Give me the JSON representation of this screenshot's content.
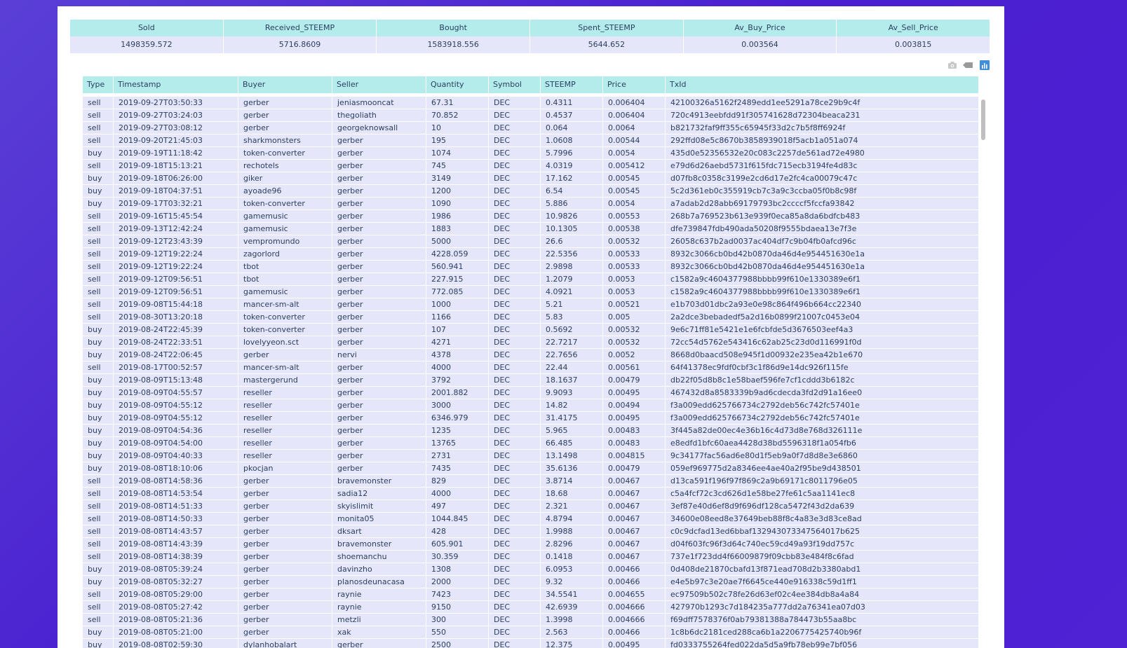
{
  "summary": {
    "headers": [
      "Sold",
      "Received_STEEMP",
      "Bought",
      "Spent_STEEMP",
      "Av_Buy_Price",
      "Av_Sell_Price"
    ],
    "values": [
      "1498359.572",
      "5716.8609",
      "1583918.556",
      "5644.652",
      "0.003564",
      "0.003815"
    ]
  },
  "modebar": {
    "icons": [
      "camera-icon",
      "eraser-icon",
      "bar-chart-icon"
    ]
  },
  "table": {
    "headers": [
      "Type",
      "Timestamp",
      "Buyer",
      "Seller",
      "Quantity",
      "Symbol",
      "STEEMP",
      "Price",
      "TxId"
    ],
    "rows": [
      [
        "sell",
        "2019-09-27T03:50:33",
        "gerber",
        "jeniasmooncat",
        "67.31",
        "DEC",
        "0.4311",
        "0.006404",
        "42100326a5162f2489edd1ee5291a78ce29b9c4f"
      ],
      [
        "sell",
        "2019-09-27T03:24:03",
        "gerber",
        "thegoliath",
        "70.852",
        "DEC",
        "0.4537",
        "0.006404",
        "720c4913eebfdd91f305741628d72304beaca231"
      ],
      [
        "sell",
        "2019-09-27T03:08:12",
        "gerber",
        "georgeknowsall",
        "10",
        "DEC",
        "0.064",
        "0.0064",
        "b821732faf9ff355c65945f33d2c7b5f8ff6924f"
      ],
      [
        "sell",
        "2019-09-20T21:45:03",
        "sharkmonsters",
        "gerber",
        "195",
        "DEC",
        "1.0608",
        "0.00544",
        "292ffd08e5c8670b3858939018f5acb1a051a074"
      ],
      [
        "buy",
        "2019-09-19T11:18:42",
        "token-converter",
        "gerber",
        "1074",
        "DEC",
        "5.7996",
        "0.0054",
        "435d0e52356532e20c083c2257de561ad72e4980"
      ],
      [
        "sell",
        "2019-09-18T15:13:21",
        "rechotels",
        "gerber",
        "745",
        "DEC",
        "4.0319",
        "0.005412",
        "e79d6d26aebd5731f615fdc715ecb3194fe4d83c"
      ],
      [
        "buy",
        "2019-09-18T06:26:00",
        "giker",
        "gerber",
        "3149",
        "DEC",
        "17.162",
        "0.00545",
        "d07fb8c0358c3199e2cd6d17e2fc4ca00079c47c"
      ],
      [
        "buy",
        "2019-09-18T04:37:51",
        "ayoade96",
        "gerber",
        "1200",
        "DEC",
        "6.54",
        "0.00545",
        "5c2d361eb0c355919cb7c3a9c3ccba05f0b8c98f"
      ],
      [
        "buy",
        "2019-09-17T03:32:21",
        "token-converter",
        "gerber",
        "1090",
        "DEC",
        "5.886",
        "0.0054",
        "a7adab2d28abb69179793bc2ccccf5fccfa93842"
      ],
      [
        "sell",
        "2019-09-16T15:45:54",
        "gamemusic",
        "gerber",
        "1986",
        "DEC",
        "10.9826",
        "0.00553",
        "268b7a769523b613e939f0eca85a8da6bdfcb483"
      ],
      [
        "sell",
        "2019-09-13T12:42:24",
        "gamemusic",
        "gerber",
        "1883",
        "DEC",
        "10.1305",
        "0.00538",
        "dfe739847fdb490ada50208f9555bdaea13e7f3e"
      ],
      [
        "sell",
        "2019-09-12T23:43:39",
        "vempromundo",
        "gerber",
        "5000",
        "DEC",
        "26.6",
        "0.00532",
        "26058c637b2ad0037ac404df7c9b04fb0afcd96c"
      ],
      [
        "sell",
        "2019-09-12T19:22:24",
        "zagorlord",
        "gerber",
        "4228.059",
        "DEC",
        "22.5356",
        "0.00533",
        "8932c3066cb0bd42b0870da46d4e954451630e1a"
      ],
      [
        "sell",
        "2019-09-12T19:22:24",
        "tbot",
        "gerber",
        "560.941",
        "DEC",
        "2.9898",
        "0.00533",
        "8932c3066cb0bd42b0870da46d4e954451630e1a"
      ],
      [
        "sell",
        "2019-09-12T09:56:51",
        "tbot",
        "gerber",
        "227.915",
        "DEC",
        "1.2079",
        "0.0053",
        "c1582a9c4604377988bbbb99f610e1330389e6f1"
      ],
      [
        "sell",
        "2019-09-12T09:56:51",
        "gamemusic",
        "gerber",
        "772.085",
        "DEC",
        "4.0921",
        "0.0053",
        "c1582a9c4604377988bbbb99f610e1330389e6f1"
      ],
      [
        "sell",
        "2019-09-08T15:44:18",
        "mancer-sm-alt",
        "gerber",
        "1000",
        "DEC",
        "5.21",
        "0.00521",
        "e1b703d01dbc2a93e0e98c864f496b664cc22340"
      ],
      [
        "sell",
        "2019-08-30T13:20:18",
        "token-converter",
        "gerber",
        "1166",
        "DEC",
        "5.83",
        "0.005",
        "2a2dce3bebadedf5a2d16b0899f21007c0453e04"
      ],
      [
        "buy",
        "2019-08-24T22:45:39",
        "token-converter",
        "gerber",
        "107",
        "DEC",
        "0.5692",
        "0.00532",
        "9e6c71ff81e5421e1e6fcbfde5d3676503eef4a3"
      ],
      [
        "buy",
        "2019-08-24T22:33:51",
        "lovelyyeon.sct",
        "gerber",
        "4271",
        "DEC",
        "22.7217",
        "0.00532",
        "72cc54d5762e543416c62ab25c23d0d116991f0d"
      ],
      [
        "buy",
        "2019-08-24T22:06:45",
        "gerber",
        "nervi",
        "4378",
        "DEC",
        "22.7656",
        "0.0052",
        "8668d0baacd508e945f1d00932e235ea42b1e670"
      ],
      [
        "sell",
        "2019-08-17T00:52:57",
        "mancer-sm-alt",
        "gerber",
        "4000",
        "DEC",
        "22.44",
        "0.00561",
        "64f41378ec9fdf0cbf3c1f86d9e14dc926f115fe"
      ],
      [
        "buy",
        "2019-08-09T15:13:48",
        "mastergerund",
        "gerber",
        "3792",
        "DEC",
        "18.1637",
        "0.00479",
        "db22f05d8b8c1e58baef596fe7cf1cddd3b6182c"
      ],
      [
        "buy",
        "2019-08-09T04:55:57",
        "reseller",
        "gerber",
        "2001.882",
        "DEC",
        "9.9093",
        "0.00495",
        "467432d8a8583339b9ad6cdecda3fd2d91a16ee0"
      ],
      [
        "buy",
        "2019-08-09T04:55:12",
        "reseller",
        "gerber",
        "3000",
        "DEC",
        "14.82",
        "0.00494",
        "f3a009edd625766734c2792deb56c742fc57401e"
      ],
      [
        "buy",
        "2019-08-09T04:55:12",
        "reseller",
        "gerber",
        "6346.979",
        "DEC",
        "31.4175",
        "0.00495",
        "f3a009edd625766734c2792deb56c742fc57401e"
      ],
      [
        "buy",
        "2019-08-09T04:54:36",
        "reseller",
        "gerber",
        "1235",
        "DEC",
        "5.965",
        "0.00483",
        "3f445a82de00ec4e36b16c4d73d8e768d326111e"
      ],
      [
        "buy",
        "2019-08-09T04:54:00",
        "reseller",
        "gerber",
        "13765",
        "DEC",
        "66.485",
        "0.00483",
        "e8edfd1bfc60aea4428d38bd5596318f1a054fb6"
      ],
      [
        "buy",
        "2019-08-09T04:40:33",
        "reseller",
        "gerber",
        "2731",
        "DEC",
        "13.1498",
        "0.004815",
        "9c34177fac56ad6e80d1f5eb9a0f7d8d8e3e6860"
      ],
      [
        "buy",
        "2019-08-08T18:10:06",
        "pkocjan",
        "gerber",
        "7435",
        "DEC",
        "35.6136",
        "0.00479",
        "059ef969775d2a8346ee4ae40a2f95be9d438501"
      ],
      [
        "sell",
        "2019-08-08T14:58:36",
        "gerber",
        "bravemonster",
        "829",
        "DEC",
        "3.8714",
        "0.00467",
        "d13ca591f196f97f869c2a9b69171c8011796e05"
      ],
      [
        "sell",
        "2019-08-08T14:53:54",
        "gerber",
        "sadia12",
        "4000",
        "DEC",
        "18.68",
        "0.00467",
        "c5a4fcf72c3cd626d1e58be27fe61c5aa1141ec8"
      ],
      [
        "sell",
        "2019-08-08T14:51:33",
        "gerber",
        "skyislimit",
        "497",
        "DEC",
        "2.321",
        "0.00467",
        "3ef87e40d6ef8d9f696df128ca5472f43d2da639"
      ],
      [
        "sell",
        "2019-08-08T14:50:33",
        "gerber",
        "monita05",
        "1044.845",
        "DEC",
        "4.8794",
        "0.00467",
        "34600e08eed8e37649beb88f8c4a83e3d83ce8ad"
      ],
      [
        "sell",
        "2019-08-08T14:43:57",
        "gerber",
        "dksart",
        "428",
        "DEC",
        "1.9988",
        "0.00467",
        "c0c9dcfad13ed6bbaf132943073347564017b625"
      ],
      [
        "sell",
        "2019-08-08T14:43:39",
        "gerber",
        "bravemonster",
        "605.901",
        "DEC",
        "2.8296",
        "0.00467",
        "d04f603fc96f3d64c740ec59cd49a93f19dd757c"
      ],
      [
        "sell",
        "2019-08-08T14:38:39",
        "gerber",
        "shoemanchu",
        "30.359",
        "DEC",
        "0.1418",
        "0.00467",
        "737e1f723dd4f66009879f09cbb83e484f8c6fad"
      ],
      [
        "buy",
        "2019-08-08T05:39:24",
        "gerber",
        "davinzho",
        "1308",
        "DEC",
        "6.0953",
        "0.00466",
        "0d408de21870cbafd13f871ead708d2b3380abd1"
      ],
      [
        "buy",
        "2019-08-08T05:32:27",
        "gerber",
        "planosdeunacasa",
        "2000",
        "DEC",
        "9.32",
        "0.00466",
        "e4e5b97c3e20ae7f6645ce440e916338c59d1ff1"
      ],
      [
        "sell",
        "2019-08-08T05:29:00",
        "gerber",
        "raynie",
        "7423",
        "DEC",
        "34.5541",
        "0.004655",
        "ec97509b502c78fe26d63ef02c4ee384db8a4a84"
      ],
      [
        "sell",
        "2019-08-08T05:27:42",
        "gerber",
        "raynie",
        "9150",
        "DEC",
        "42.6939",
        "0.004666",
        "427970b1293c7d184235a777dd2a76341ea07d03"
      ],
      [
        "sell",
        "2019-08-08T05:21:36",
        "gerber",
        "metzli",
        "300",
        "DEC",
        "1.3998",
        "0.004666",
        "f69dff7578376f0ab79381388a784473b55aa8bc"
      ],
      [
        "buy",
        "2019-08-08T05:21:00",
        "gerber",
        "xak",
        "550",
        "DEC",
        "2.563",
        "0.00466",
        "1c8b6dc2181ced288ca6b1a2206775425740b96f"
      ],
      [
        "buy",
        "2019-08-08T02:59:30",
        "dylanhobalart",
        "gerber",
        "2500",
        "DEC",
        "12.375",
        "0.00495",
        "fd0333755264fed022da5d5a9fb78eb99e7bf056"
      ]
    ]
  }
}
